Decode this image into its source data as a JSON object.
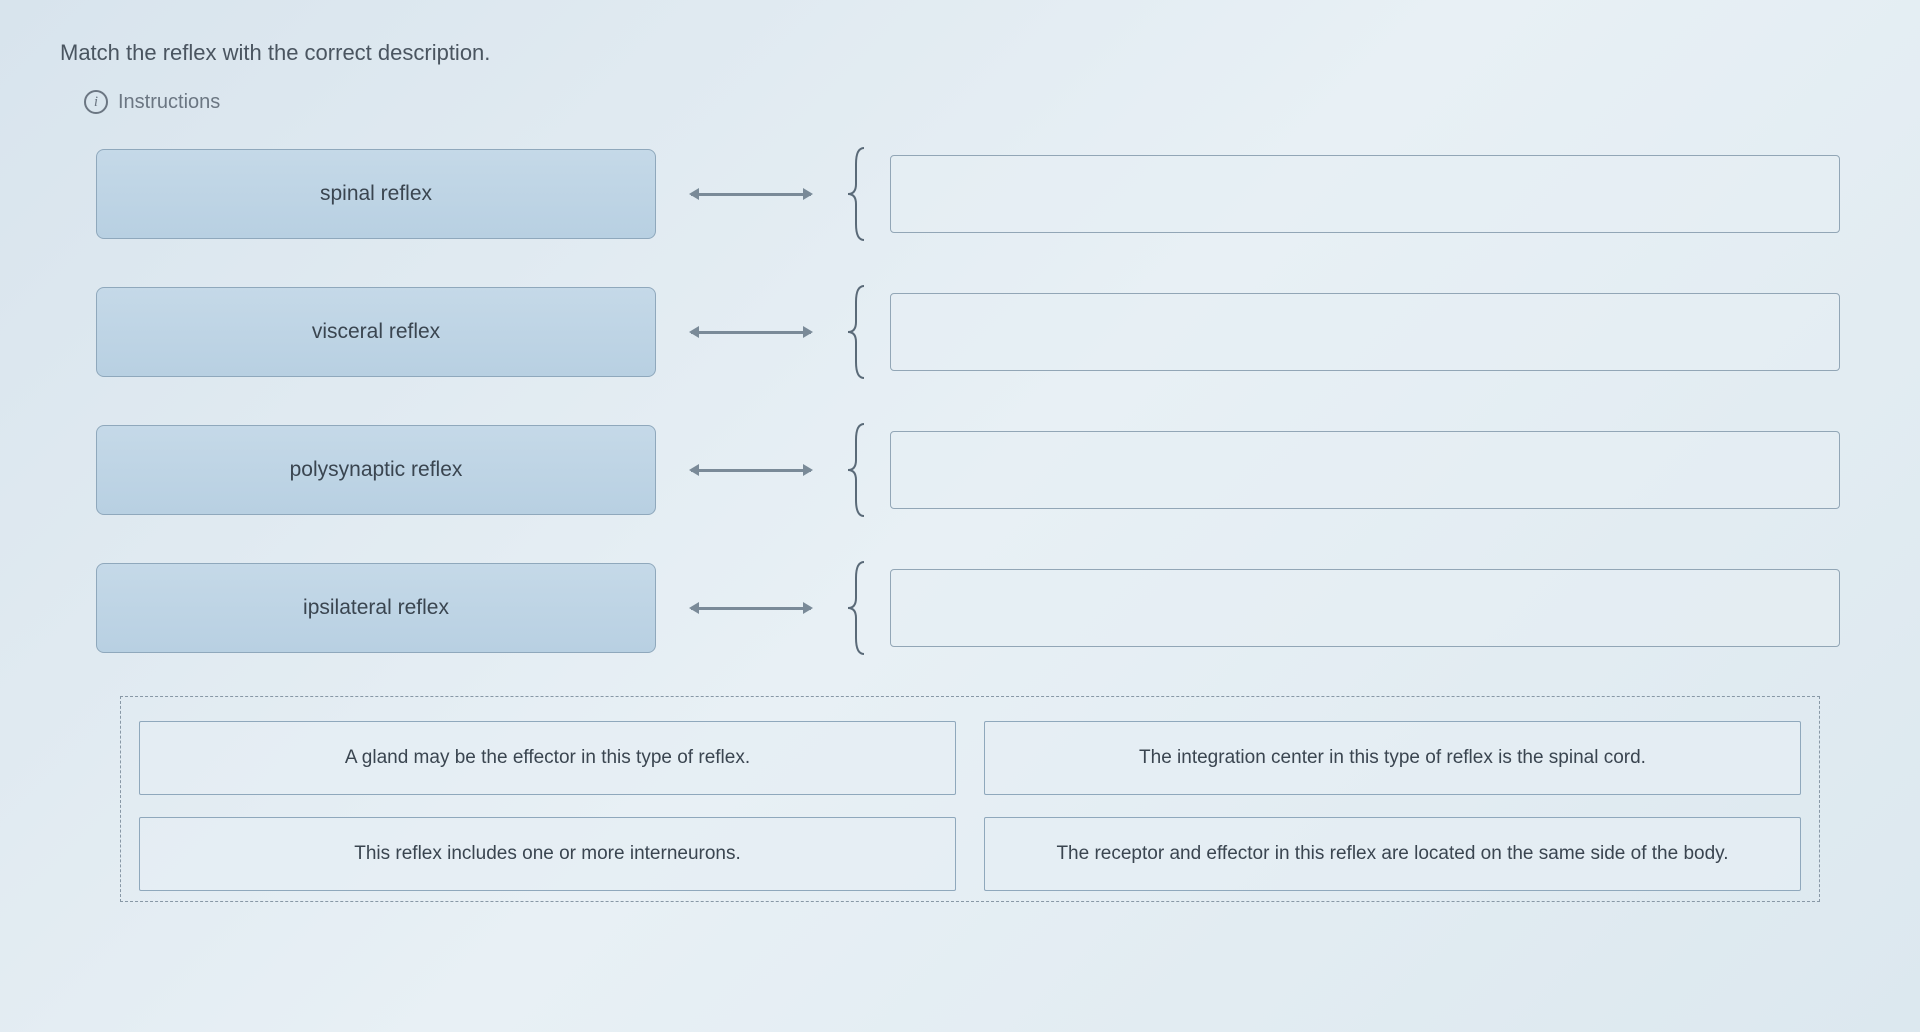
{
  "question": {
    "prompt": "Match the reflex with the correct description.",
    "instructions_label": "Instructions"
  },
  "terms": [
    {
      "label": "spinal reflex"
    },
    {
      "label": "visceral reflex"
    },
    {
      "label": "polysynaptic reflex"
    },
    {
      "label": "ipsilateral reflex"
    }
  ],
  "answers": [
    {
      "text": "A gland may be the effector in this type of reflex."
    },
    {
      "text": "The integration center in this type of reflex is the spinal cord."
    },
    {
      "text": "This reflex includes one or more interneurons."
    },
    {
      "text": "The receptor and effector in this reflex are located on the same side of the body."
    }
  ]
}
